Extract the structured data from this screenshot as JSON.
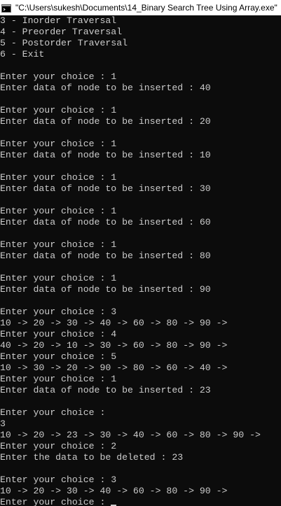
{
  "window": {
    "title": "\"C:\\Users\\sukesh\\Documents\\14_Binary Search Tree Using Array.exe\""
  },
  "console": {
    "lines": [
      "3 - Inorder Traversal",
      "4 - Preorder Traversal",
      "5 - Postorder Traversal",
      "6 - Exit",
      "",
      "Enter your choice : 1",
      "Enter data of node to be inserted : 40",
      "",
      "Enter your choice : 1",
      "Enter data of node to be inserted : 20",
      "",
      "Enter your choice : 1",
      "Enter data of node to be inserted : 10",
      "",
      "Enter your choice : 1",
      "Enter data of node to be inserted : 30",
      "",
      "Enter your choice : 1",
      "Enter data of node to be inserted : 60",
      "",
      "Enter your choice : 1",
      "Enter data of node to be inserted : 80",
      "",
      "Enter your choice : 1",
      "Enter data of node to be inserted : 90",
      "",
      "Enter your choice : 3",
      "10 -> 20 -> 30 -> 40 -> 60 -> 80 -> 90 ->",
      "Enter your choice : 4",
      "40 -> 20 -> 10 -> 30 -> 60 -> 80 -> 90 ->",
      "Enter your choice : 5",
      "10 -> 30 -> 20 -> 90 -> 80 -> 60 -> 40 ->",
      "Enter your choice : 1",
      "Enter data of node to be inserted : 23",
      "",
      "Enter your choice :",
      "3",
      "10 -> 20 -> 23 -> 30 -> 40 -> 60 -> 80 -> 90 ->",
      "Enter your choice : 2",
      "Enter the data to be deleted : 23",
      "",
      "Enter your choice : 3",
      "10 -> 20 -> 30 -> 40 -> 60 -> 80 -> 90 ->"
    ],
    "prompt_line": "Enter your choice : "
  },
  "colors": {
    "background": "#0c0c0c",
    "text": "#cccccc",
    "titlebar": "#ffffff"
  }
}
